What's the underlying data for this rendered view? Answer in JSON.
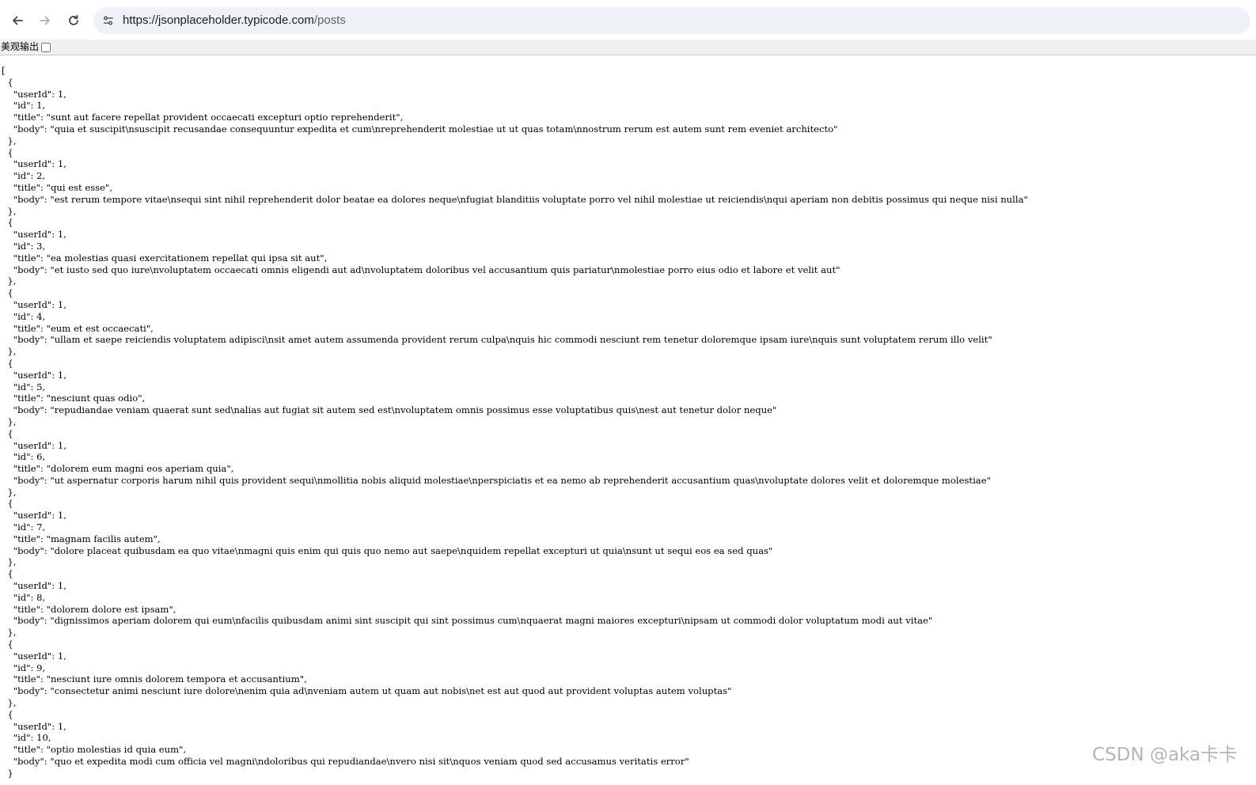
{
  "browser": {
    "url_host": "https://jsonplaceholder.typicode.com",
    "url_path": "/posts",
    "icons": [
      "back-arrow-icon",
      "forward-arrow-icon",
      "reload-icon",
      "site-info-icon"
    ]
  },
  "viewer": {
    "pretty_print_label": "美观输出",
    "pretty_print_checked": false
  },
  "posts": [
    {
      "userId": 1,
      "id": 1,
      "title": "sunt aut facere repellat provident occaecati excepturi optio reprehenderit",
      "body": "quia et suscipit\\nsuscipit recusandae consequuntur expedita et cum\\nreprehenderit molestiae ut ut quas totam\\nnostrum rerum est autem sunt rem eveniet architecto"
    },
    {
      "userId": 1,
      "id": 2,
      "title": "qui est esse",
      "body": "est rerum tempore vitae\\nsequi sint nihil reprehenderit dolor beatae ea dolores neque\\nfugiat blanditiis voluptate porro vel nihil molestiae ut reiciendis\\nqui aperiam non debitis possimus qui neque nisi nulla"
    },
    {
      "userId": 1,
      "id": 3,
      "title": "ea molestias quasi exercitationem repellat qui ipsa sit aut",
      "body": "et iusto sed quo iure\\nvoluptatem occaecati omnis eligendi aut ad\\nvoluptatem doloribus vel accusantium quis pariatur\\nmolestiae porro eius odio et labore et velit aut"
    },
    {
      "userId": 1,
      "id": 4,
      "title": "eum et est occaecati",
      "body": "ullam et saepe reiciendis voluptatem adipisci\\nsit amet autem assumenda provident rerum culpa\\nquis hic commodi nesciunt rem tenetur doloremque ipsam iure\\nquis sunt voluptatem rerum illo velit"
    },
    {
      "userId": 1,
      "id": 5,
      "title": "nesciunt quas odio",
      "body": "repudiandae veniam quaerat sunt sed\\nalias aut fugiat sit autem sed est\\nvoluptatem omnis possimus esse voluptatibus quis\\nest aut tenetur dolor neque"
    },
    {
      "userId": 1,
      "id": 6,
      "title": "dolorem eum magni eos aperiam quia",
      "body": "ut aspernatur corporis harum nihil quis provident sequi\\nmollitia nobis aliquid molestiae\\nperspiciatis et ea nemo ab reprehenderit accusantium quas\\nvoluptate dolores velit et doloremque molestiae"
    },
    {
      "userId": 1,
      "id": 7,
      "title": "magnam facilis autem",
      "body": "dolore placeat quibusdam ea quo vitae\\nmagni quis enim qui quis quo nemo aut saepe\\nquidem repellat excepturi ut quia\\nsunt ut sequi eos ea sed quas"
    },
    {
      "userId": 1,
      "id": 8,
      "title": "dolorem dolore est ipsam",
      "body": "dignissimos aperiam dolorem qui eum\\nfacilis quibusdam animi sint suscipit qui sint possimus cum\\nquaerat magni maiores excepturi\\nipsam ut commodi dolor voluptatum modi aut vitae"
    },
    {
      "userId": 1,
      "id": 9,
      "title": "nesciunt iure omnis dolorem tempora et accusantium",
      "body": "consectetur animi nesciunt iure dolore\\nenim quia ad\\nveniam autem ut quam aut nobis\\net est aut quod aut provident voluptas autem voluptas"
    },
    {
      "userId": 1,
      "id": 10,
      "title": "optio molestias id quia eum",
      "body": "quo et expedita modi cum officia vel magni\\ndoloribus qui repudiandae\\nvero nisi sit\\nquos veniam quod sed accusamus veritatis error"
    }
  ],
  "watermark": "CSDN @aka卡卡"
}
